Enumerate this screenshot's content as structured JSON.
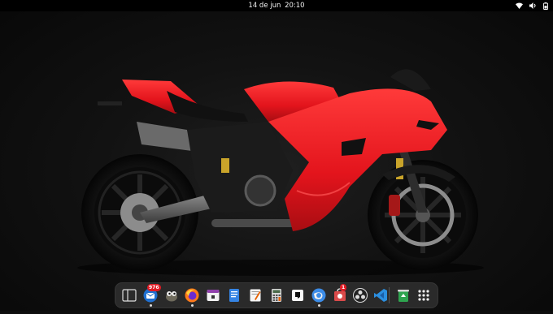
{
  "topbar": {
    "date": "14 de jun",
    "time": "20:10",
    "tray_icons": [
      "wifi-icon",
      "volume-icon",
      "battery-icon"
    ]
  },
  "wallpaper": {
    "subject": "motorcycle",
    "accent": "#e3141c"
  },
  "dock": {
    "apps": [
      {
        "name": "workspaces-overview",
        "icon": "overview-icon"
      },
      {
        "name": "thunderbird",
        "icon": "thunderbird-icon",
        "badge": "976",
        "running": true
      },
      {
        "name": "gimp",
        "icon": "gimp-icon"
      },
      {
        "name": "firefox",
        "icon": "firefox-icon",
        "running": true
      },
      {
        "name": "calendar",
        "icon": "calendar-icon"
      },
      {
        "name": "documents",
        "icon": "documents-icon"
      },
      {
        "name": "text-editor",
        "icon": "text-editor-icon"
      },
      {
        "name": "calculator",
        "icon": "calculator-icon"
      },
      {
        "name": "notes",
        "icon": "notes-icon"
      },
      {
        "name": "browser",
        "icon": "globe-icon",
        "running": true
      },
      {
        "name": "software",
        "icon": "software-icon",
        "badge": "1"
      },
      {
        "name": "obs-studio",
        "icon": "obs-icon"
      },
      {
        "name": "vscode",
        "icon": "vscode-icon"
      },
      {
        "name": "trash",
        "icon": "trash-icon"
      },
      {
        "name": "show-apps",
        "icon": "app-grid-icon"
      }
    ]
  }
}
